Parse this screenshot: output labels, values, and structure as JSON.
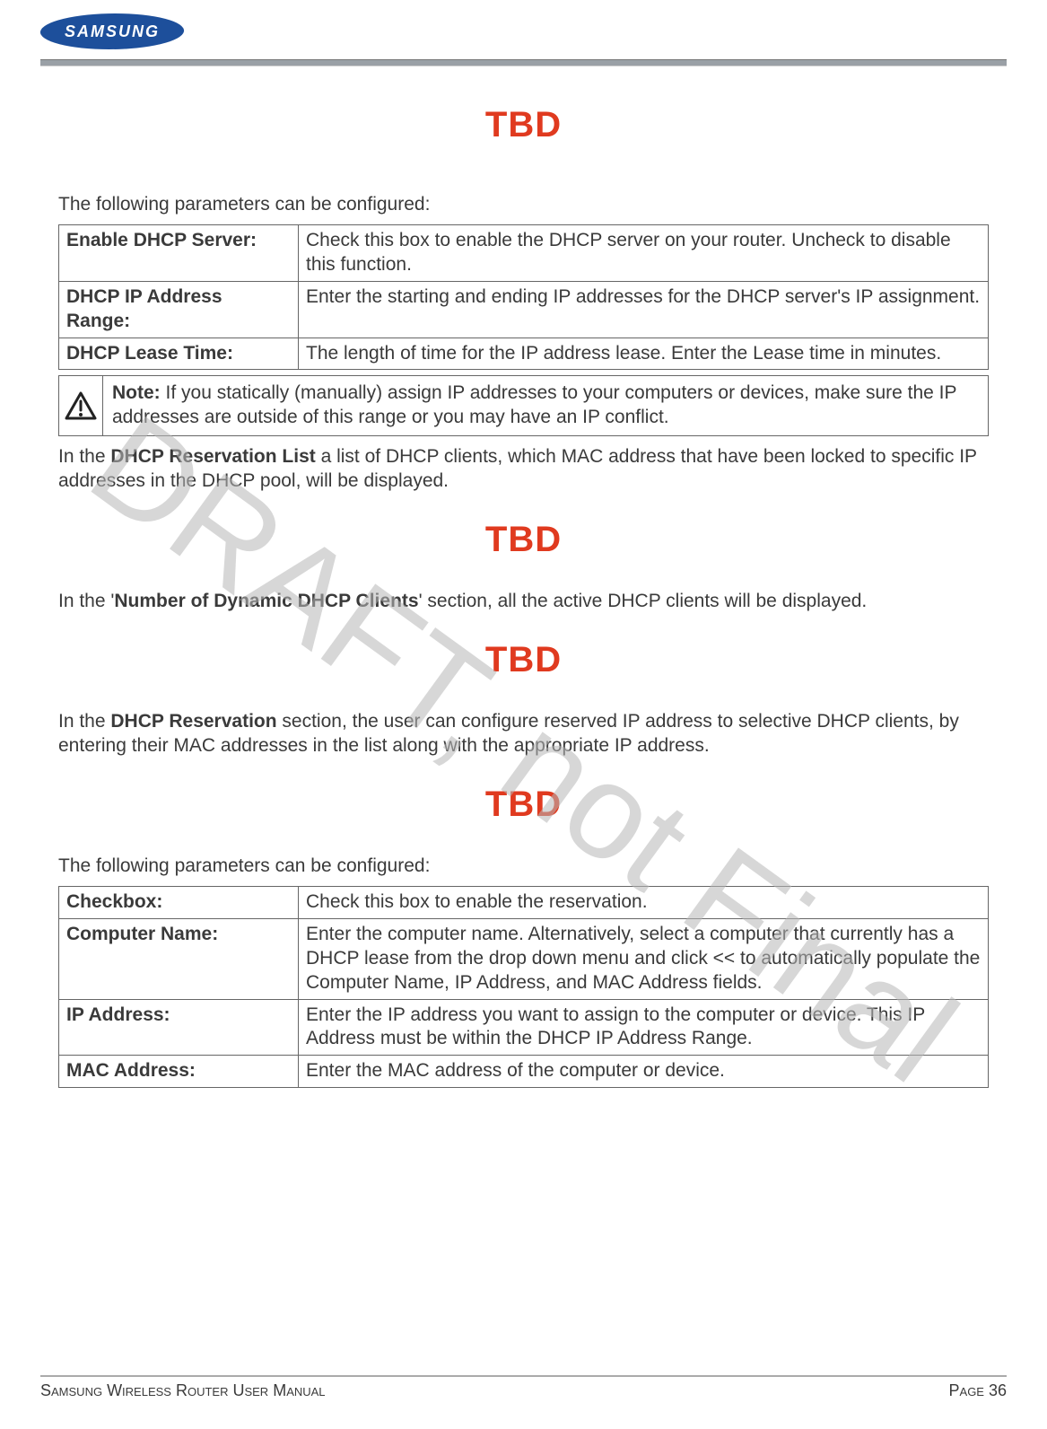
{
  "logo_text": "SAMSUNG",
  "tbd": "TBD",
  "watermark": "DRAFT, not Final",
  "intro1": "The following parameters can be configured:",
  "table1": {
    "rows": [
      {
        "label": "Enable DHCP Server:",
        "desc": "Check this box to enable the DHCP server on your router. Uncheck to disable this function."
      },
      {
        "label": "DHCP IP Address Range:",
        "desc": "Enter the starting and ending IP addresses for the DHCP server's IP assignment."
      },
      {
        "label": "DHCP Lease Time:",
        "desc": "The length of time for the IP address lease. Enter the Lease time in minutes."
      }
    ]
  },
  "note": {
    "label": "Note:",
    "text": " If you statically (manually) assign IP addresses to your computers or devices, make sure the IP addresses are outside of this range or you may have an IP conflict."
  },
  "para_reservation_list_pre": "In the ",
  "para_reservation_list_strong": "DHCP Reservation List",
  "para_reservation_list_post": " a list of DHCP clients, which MAC address that have been locked to specific IP addresses in the DHCP pool, will be displayed.",
  "para_dynamic_pre": "In the '",
  "para_dynamic_strong": "Number of Dynamic DHCP Clients",
  "para_dynamic_post": "' section, all the active DHCP clients will be displayed.",
  "para_reservation_pre": "In the ",
  "para_reservation_strong": "DHCP Reservation",
  "para_reservation_post": " section, the user can configure reserved IP address to selective DHCP clients, by entering their MAC addresses in the list along with the appropriate IP address.",
  "intro2": "The following parameters can be configured:",
  "table2": {
    "rows": [
      {
        "label": "Checkbox:",
        "desc": "Check this box to enable the reservation."
      },
      {
        "label": "Computer Name:",
        "desc": "Enter the computer name. Alternatively, select a computer that currently has a DHCP lease from the drop down menu and click << to automatically populate the Computer Name, IP Address, and MAC Address fields."
      },
      {
        "label": "IP Address:",
        "desc": "Enter the IP address you want to assign to the computer or device. This IP Address must be within the DHCP IP Address Range."
      },
      {
        "label": "MAC Address:",
        "desc": "Enter the MAC address of the computer or device."
      }
    ]
  },
  "footer_left": "Samsung Wireless Router User Manual",
  "footer_right": "Page 36"
}
